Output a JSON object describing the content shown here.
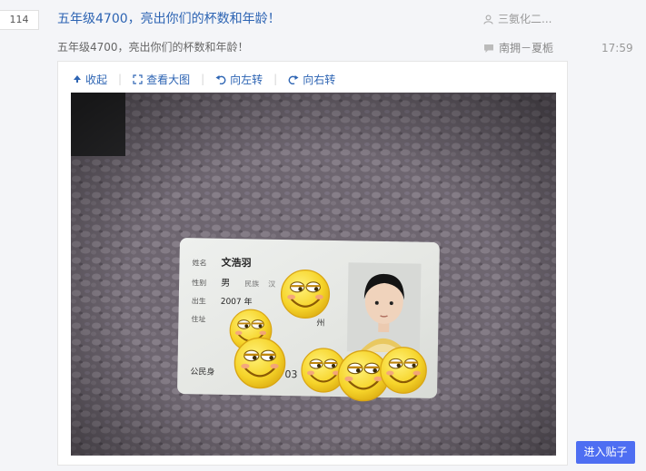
{
  "thread": {
    "reply_count": "114",
    "title": "五年级4700，亮出你们的杯数和年龄！",
    "author": "三氨化二...",
    "snippet": "五年级4700，亮出你们的杯数和年龄！",
    "last_reply_user": "南拥－夏栀",
    "last_reply_time": "17:59"
  },
  "media_toolbar": {
    "collapse_label": "收起",
    "view_large_label": "查看大图",
    "rotate_left_label": "向左转",
    "rotate_right_label": "向右转"
  },
  "photo": {
    "card_name_label": "姓名",
    "card_name": "文浩羽",
    "card_sex_label": "性别",
    "card_sex": "男",
    "card_ethnicity_label": "民族",
    "card_ethnicity": "汉",
    "card_birth_label": "出生",
    "card_birth": "2007 年",
    "card_address_label": "住址",
    "card_address_suffix": "州",
    "card_id_label": "公民身",
    "card_id_fragment": "03"
  },
  "actions": {
    "enter_thread_label": "进入贴子"
  },
  "icons": [
    "user-icon",
    "comment-icon",
    "collapse-icon",
    "zoom-icon",
    "rotate-left-icon",
    "rotate-right-icon"
  ],
  "colors": {
    "link_blue": "#2d64b3",
    "button_blue": "#4e6ef2",
    "page_bg": "#f4f5f8"
  }
}
